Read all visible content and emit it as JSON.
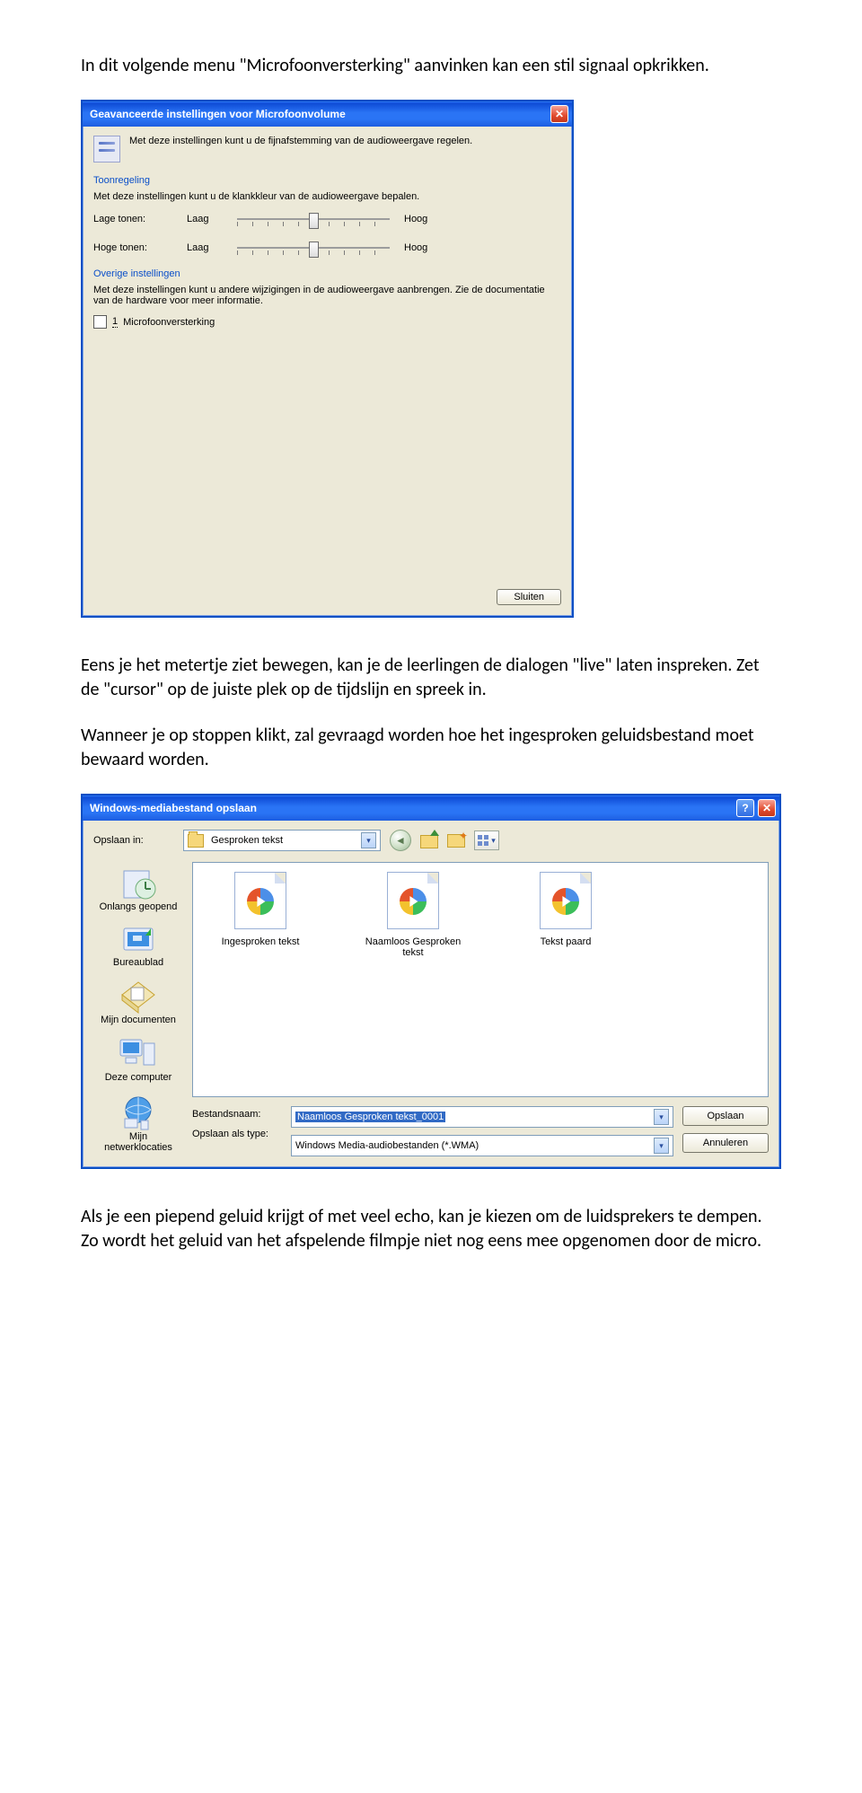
{
  "para1": "In dit volgende menu \"Microfoonversterking\" aanvinken kan een stil signaal opkrikken.",
  "para2": "Eens je het metertje ziet bewegen, kan je de leerlingen de dialogen \"live\" laten inspreken. Zet de \"cursor\" op de juiste plek op de tijdslijn en spreek in.",
  "para3": "Wanneer je op stoppen klikt, zal gevraagd worden hoe het ingesproken geluidsbestand moet bewaard worden.",
  "para4": "Als je een piepend geluid krijgt of met veel echo, kan je kiezen om de luidsprekers te dempen. Zo wordt het geluid van het afspelende filmpje niet nog eens mee opgenomen door de micro.",
  "dialog1": {
    "title": "Geavanceerde instellingen voor Microfoonvolume",
    "intro": "Met deze instellingen kunt u de fijnafstemming van de audioweergave regelen.",
    "section_tone": "Toonregeling",
    "tone_desc": "Met deze instellingen kunt u de klankkleur van de audioweergave bepalen.",
    "low_label": "Lage tonen:",
    "high_label": "Hoge tonen:",
    "laag": "Laag",
    "hoog": "Hoog",
    "section_other": "Overige instellingen",
    "other_desc": "Met deze instellingen kunt u andere wijzigingen in de audioweergave aanbrengen. Zie de documentatie van de hardware voor meer informatie.",
    "cb_prefix": "1",
    "cb_label": "Microfoonversterking",
    "close": "Sluiten"
  },
  "dialog2": {
    "title": "Windows-mediabestand opslaan",
    "save_in_label": "Opslaan in:",
    "save_in_value": "Gesproken tekst",
    "places": {
      "recent": "Onlangs geopend",
      "desktop": "Bureaublad",
      "docs": "Mijn documenten",
      "computer": "Deze computer",
      "network": "Mijn netwerklocaties"
    },
    "files": {
      "f1": "Ingesproken tekst",
      "f2": "Naamloos Gesproken tekst",
      "f3": "Tekst paard"
    },
    "filename_label": "Bestandsnaam:",
    "filename_value": "Naamloos Gesproken tekst_0001",
    "filetype_label": "Opslaan als type:",
    "filetype_value": "Windows Media-audiobestanden (*.WMA)",
    "save_btn": "Opslaan",
    "cancel_btn": "Annuleren"
  }
}
